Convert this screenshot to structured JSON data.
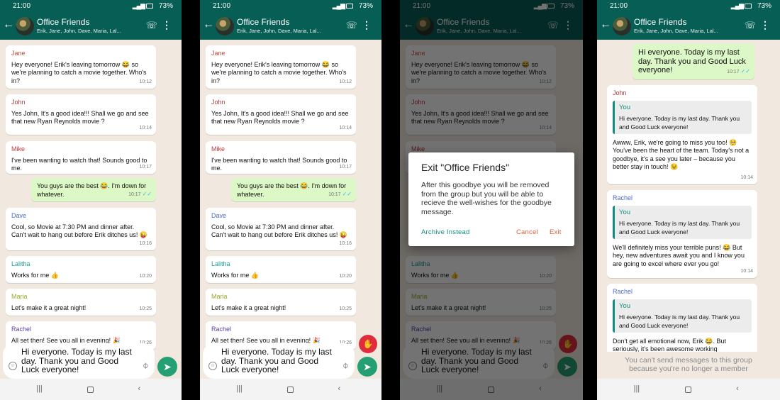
{
  "status": {
    "time": "21:00",
    "battery": "73%"
  },
  "header": {
    "title": "Office Friends",
    "members": "Erik, Jane, John, Dave, Maria, Lal..."
  },
  "messages": {
    "jane": {
      "sender": "Jane",
      "text": "Hey everyone! Erik's leaving tomorrow 😂 so we're planning to catch a movie together. Who's in?",
      "time": "10:12"
    },
    "john": {
      "sender": "John",
      "text": "Yes John, It's a good idea!!! Shall we go and  see that new Ryan Reynolds movie ?",
      "time": "10:14"
    },
    "mike": {
      "sender": "Mike",
      "text": "I've been wanting to watch that! Sounds good to me.",
      "time": "10:17"
    },
    "mine": {
      "text": "You guys are the best 😂. I'm down for whatever.",
      "time": "10:17"
    },
    "dave": {
      "sender": "Dave",
      "text": "Cool, so Movie at 7:30 PM and dinner after. Can't wait to hang out before Erik ditches us! 😜",
      "time": "10:16"
    },
    "lalitha": {
      "sender": "Lalitha",
      "text": "Works for me 👍",
      "time": "10:20"
    },
    "maria": {
      "sender": "Maria",
      "text": "Let's make it a great night!",
      "time": "10:25"
    },
    "rachel": {
      "sender": "Rachel",
      "text": "All set then! See you all in evening! 🎉",
      "time": "10:26"
    }
  },
  "composer": {
    "draft": "Hi everyone. Today is my last day. Thank you and Good Luck everyone!"
  },
  "dialog": {
    "title": "Exit \"Office Friends\"",
    "body": "After this goodbye you will be removed from the group but you will be able to recieve the well-wishes for the goodbye message.",
    "archive": "Archive Instead",
    "cancel": "Cancel",
    "exit": "Exit"
  },
  "screen4": {
    "goodbye": {
      "text": "Hi everyone. Today is my last day. Thank you and Good Luck everyone!",
      "time": "10:17"
    },
    "quote": {
      "name": "You",
      "text": "Hi everyone. Today is my last day. Thank you and Good Luck everyone!"
    },
    "replies": [
      {
        "sender": "John",
        "text": "Awww, Erik, we're going to miss you too! 🥺 You've been the heart of the team. Today's not a goodbye, it's a see you later – because you better stay in touch! 😉",
        "time": "10:14"
      },
      {
        "sender": "Rachel",
        "text": "We'll definitely miss your terrible puns! 😂 But hey, new adventures await you and I know you are going to excel where ever you go!",
        "time": "10:14"
      },
      {
        "sender": "Rachel",
        "text": "Don't get all emotional now, Erik 😂. But seriously, it's been awesome working"
      }
    ],
    "cant_send": "You can't send messages to  this group because you're no longer a member"
  },
  "colors": {
    "appbar": "#075e54",
    "accent": "#128c7e",
    "send": "#25a074",
    "wave": "#e02d3d",
    "outgoing": "#dcf8c6",
    "chat_bg": "#f1e9df"
  },
  "icons": [
    "back-arrow-icon",
    "group-avatar",
    "add-call-icon",
    "more-vert-icon",
    "emoji-icon",
    "attach-icon",
    "send-icon",
    "wave-icon",
    "read-ticks-icon",
    "recent-apps-icon",
    "home-icon",
    "nav-back-icon"
  ]
}
